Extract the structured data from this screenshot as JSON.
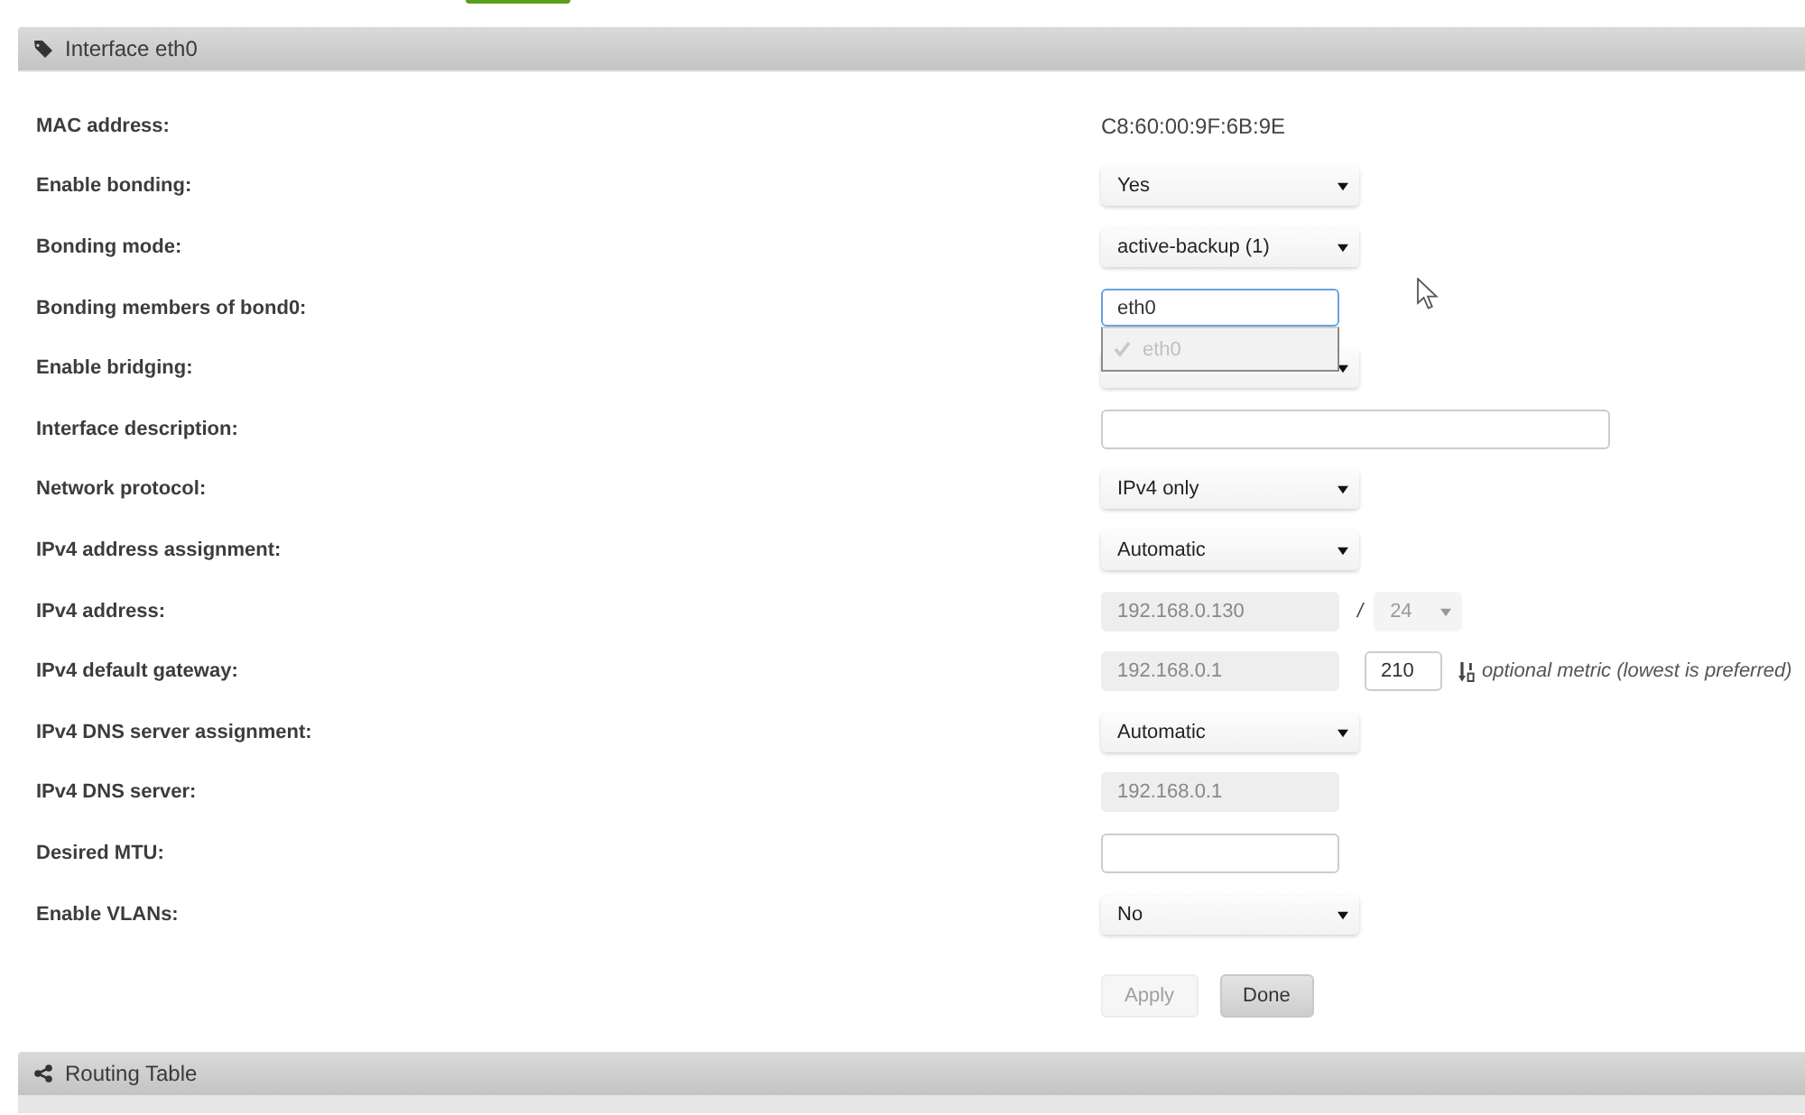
{
  "panel": {
    "title": "Interface eth0",
    "fields": [
      {
        "label": "MAC address:",
        "kind": "text",
        "value": "C8:60:00:9F:6B:9E"
      },
      {
        "label": "Enable bonding:",
        "kind": "select",
        "value": "Yes",
        "disabled": false
      },
      {
        "label": "Bonding mode:",
        "kind": "select",
        "value": "active-backup (1)",
        "disabled": false
      },
      {
        "label": "Bonding members of bond0:",
        "kind": "multiselect",
        "value": "eth0",
        "focused": true,
        "expanded": true,
        "options": [
          {
            "label": "eth0",
            "checked": true,
            "disabled": true
          }
        ]
      },
      {
        "label": "Enable bridging:",
        "kind": "select",
        "disabled": false
      },
      {
        "label": "Interface description:",
        "kind": "wide_input",
        "disabled": false
      },
      {
        "label": "Network protocol:",
        "kind": "select",
        "value": "IPv4 only",
        "disabled": false
      },
      {
        "label": "IPv4 address assignment:",
        "kind": "select",
        "value": "Automatic",
        "disabled": false
      },
      {
        "label": "IPv4 address:",
        "kind": "address",
        "value": "192.168.0.130",
        "disabled": true,
        "separator": "/",
        "prefix": {
          "value": "24",
          "disabled": true
        }
      },
      {
        "label": "IPv4 default gateway:",
        "kind": "gateway",
        "value": "192.168.0.1",
        "disabled": true,
        "metric": "210",
        "hint": "optional metric (lowest is preferred)"
      },
      {
        "label": "IPv4 DNS server assignment:",
        "kind": "select",
        "value": "Automatic",
        "disabled": false
      },
      {
        "label": "IPv4 DNS server:",
        "kind": "input",
        "value": "192.168.0.1",
        "disabled": true
      },
      {
        "label": "Desired MTU:",
        "kind": "input",
        "disabled": false
      },
      {
        "label": "Enable VLANs:",
        "kind": "select",
        "value": "No",
        "disabled": false
      }
    ],
    "buttons": [
      {
        "label": "Apply",
        "disabled": true
      },
      {
        "label": "Done",
        "disabled": false
      }
    ]
  },
  "routing_panel": {
    "title": "Routing Table"
  }
}
